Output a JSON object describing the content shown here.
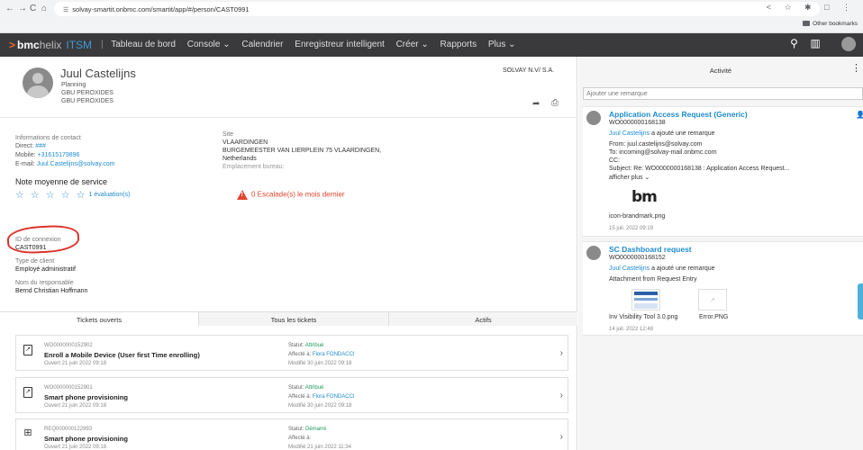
{
  "browser": {
    "url": "solvay-smartit.onbmc.com/smartit/app/#/person/CAST0991",
    "bookmarks_label": "Other bookmarks"
  },
  "appbar": {
    "brand_bmc": "bmc",
    "brand_helix": "helix",
    "brand_product": "ITSM",
    "menu": [
      "Tableau de bord",
      "Console ⌄",
      "Calendrier",
      "Enregistreur intelligent",
      "Créer ⌄",
      "Rapports",
      "Plus ⌄"
    ]
  },
  "profile": {
    "name": "Juul Castelijns",
    "role": "Planning",
    "dept1": "GBU PEROXIDES",
    "dept2": "GBU PEROXIDES",
    "company": "SOLVAY N.V/ S.A."
  },
  "contact": {
    "heading": "Informations de contact",
    "direct_label": "Direct:",
    "direct_value": "###",
    "mobile_label": "Mobile:",
    "mobile_value": "+31615179896",
    "email_label": "E-mail:",
    "email_value": "Juul.Castelijns@solvay.com"
  },
  "site": {
    "label": "Site",
    "line1": "VLAARDINGEN",
    "line2": "BURGEMEESTER VAN LIERPLEIN 75 VLAARDINGEN,",
    "line3": "Netherlands",
    "location_label": "Emplacement bureau:"
  },
  "rating": {
    "title": "Note moyenne de service",
    "stars": "☆ ☆ ☆ ☆ ☆",
    "evaluations": "1 évaluation(s)"
  },
  "escalation": {
    "text": "0 Escalade(s) le mois dernier"
  },
  "details": {
    "login_label": "ID de connexion",
    "login_value": "CAST0991",
    "client_type_label": "Type de client",
    "client_type_value": "Employé administratif",
    "manager_label": "Nom du responsable",
    "manager_value": "Bernd Christian Hoffmann"
  },
  "tabs": [
    "Tickets ouverts",
    "Tous les tickets",
    "Actifs"
  ],
  "tickets": [
    {
      "id": "WO0000000152902",
      "title": "Enroll a Mobile Device (User first Time enrolling)",
      "opened": "Ouvert 21 juin 2022 09:18",
      "status_label": "Statut:",
      "status": "Attribué",
      "assigned_label": "Affecté à:",
      "assigned": "Flora FONDACCI",
      "modified": "Modifié 30 juin 2022 09:18"
    },
    {
      "id": "WO0000000152901",
      "title": "Smart phone provisioning",
      "opened": "Ouvert 21 juin 2022 09:18",
      "status_label": "Statut:",
      "status": "Attribué",
      "assigned_label": "Affecté à:",
      "assigned": "Flora FONDACCI",
      "modified": "Modifié 30 juin 2022 09:18"
    },
    {
      "id": "REQ000000122993",
      "title": "Smart phone provisioning",
      "opened": "Ouvert 21 juin 2022 09:18",
      "status_label": "Statut:",
      "status": "Démarré",
      "assigned_label": "Affecté à:",
      "assigned": "",
      "modified": "Modifié 21 juin 2022 11:34"
    }
  ],
  "activity": {
    "title": "Activité",
    "remark_placeholder": "Ajouter une remarque",
    "items": [
      {
        "title": "Application Access Request (Generic)",
        "id": "WO0000000168138",
        "author": "Juul Castelijns",
        "action": "a ajouté une remarque",
        "from": "From: juul.castelijns@solvay.com",
        "to": "To: incoming@solvay-mail.onbmc.com",
        "cc": "CC:",
        "subject": "Subject: Re: WO0000000168138 : Application Access Request...",
        "more": "afficher plus ⌄",
        "logo_text": "bm",
        "attachment": "icon-brandmark.png",
        "date": "15 juil. 2022 09:19"
      },
      {
        "title": "SC Dashboard request",
        "id": "WO0000000168152",
        "author": "Juul Castelijns",
        "action": "a ajouté une remarque",
        "note": "Attachment from Request Entry",
        "attachment1": "Inv Visibility Tool 3.0.png",
        "attachment2": "Error.PNG",
        "date": "14 juil. 2022 12:48"
      }
    ]
  }
}
